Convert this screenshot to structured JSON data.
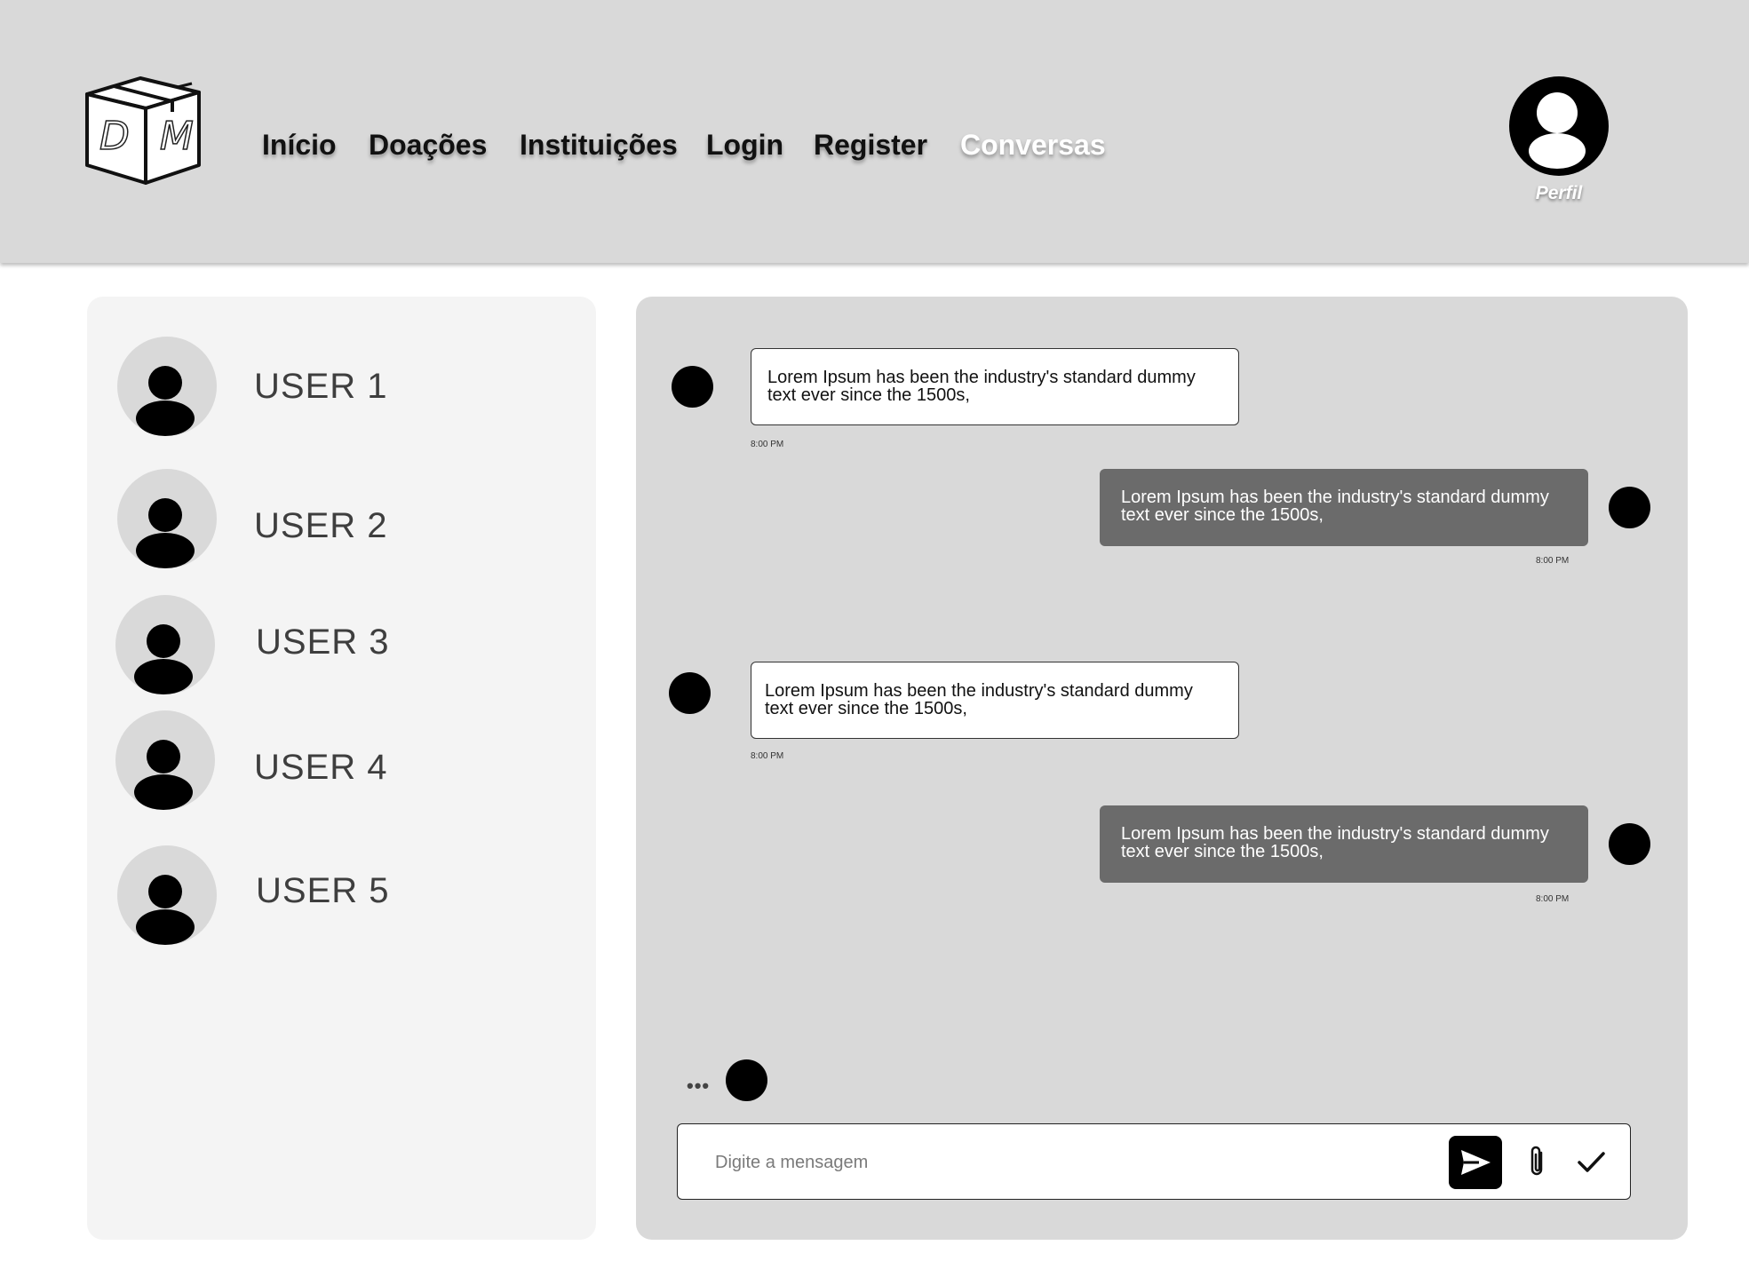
{
  "header": {
    "logo_letters": "D M",
    "nav": [
      {
        "label": "Início"
      },
      {
        "label": "Doações"
      },
      {
        "label": "Instituições"
      },
      {
        "label": "Login"
      },
      {
        "label": "Register"
      },
      {
        "label": "Conversas",
        "active": true
      }
    ],
    "profile_label": "Perfil"
  },
  "users": [
    {
      "name": "USER 1"
    },
    {
      "name": "USER 2"
    },
    {
      "name": "USER 3"
    },
    {
      "name": "USER 4"
    },
    {
      "name": "USER 5"
    }
  ],
  "messages": [
    {
      "direction": "received",
      "text": "Lorem Ipsum has been the industry's standard dummy text ever since the 1500s,",
      "time": "8:00 PM"
    },
    {
      "direction": "sent",
      "text": "Lorem Ipsum has been the industry's standard dummy text ever since the 1500s,",
      "time": "8:00 PM"
    },
    {
      "direction": "received",
      "text": "Lorem Ipsum has been the industry's standard dummy text ever since the 1500s,",
      "time": "8:00 PM"
    },
    {
      "direction": "sent",
      "text": "Lorem Ipsum has been the industry's standard dummy text ever since the 1500s,",
      "time": "8:00 PM"
    }
  ],
  "typing_indicator": "•••",
  "composer": {
    "placeholder": "Digite a mensagem",
    "value": "",
    "icons": [
      "send-icon",
      "paperclip-icon",
      "checkmark-icon"
    ]
  },
  "colors": {
    "header_bg": "#d9d9d9",
    "panel_bg": "#f4f4f4",
    "chat_bg": "#d9d9d9",
    "sent_bubble": "#6b6b6b",
    "received_bubble": "#ffffff"
  }
}
